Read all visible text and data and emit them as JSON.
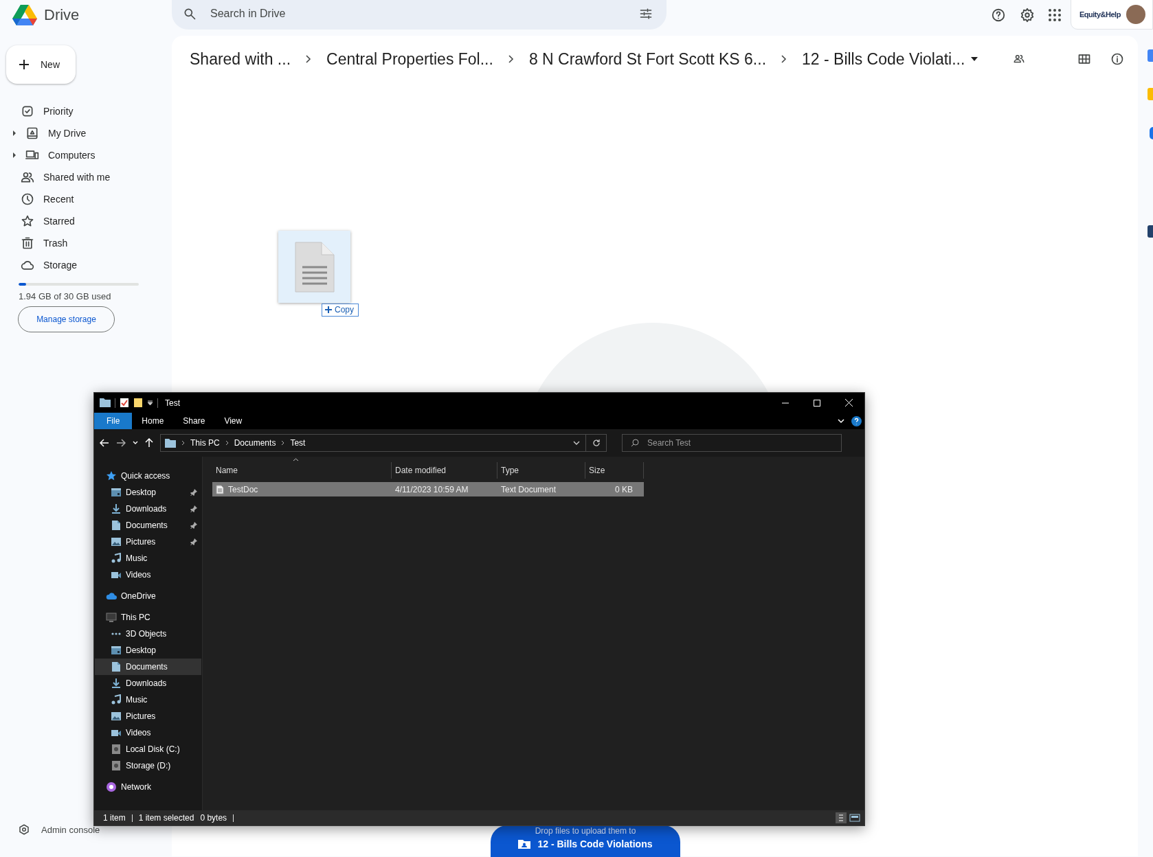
{
  "app": {
    "name": "Drive"
  },
  "search": {
    "placeholder": "Search in Drive"
  },
  "account": {
    "label": "Equity&Help"
  },
  "new_button": "New",
  "sidebar": {
    "items": [
      {
        "label": "Priority",
        "kind": "priority",
        "has_children": false
      },
      {
        "label": "My Drive",
        "kind": "drive",
        "has_children": true
      },
      {
        "label": "Computers",
        "kind": "computers",
        "has_children": true
      },
      {
        "label": "Shared with me",
        "kind": "shared",
        "has_children": false
      },
      {
        "label": "Recent",
        "kind": "recent",
        "has_children": false
      },
      {
        "label": "Starred",
        "kind": "starred",
        "has_children": false
      },
      {
        "label": "Trash",
        "kind": "trash",
        "has_children": false
      },
      {
        "label": "Storage",
        "kind": "storage",
        "has_children": false
      }
    ]
  },
  "storage": {
    "level": 0.065,
    "text": "1.94 GB of 30 GB used",
    "button": "Manage storage"
  },
  "admin": "Admin console",
  "breadcrumbs": [
    "Shared with ...",
    "Central Properties Fol...",
    "8 N Crawford St Fort Scott KS 6...",
    "12 - Bills Code Violati..."
  ],
  "drag": {
    "badge": "Copy"
  },
  "drop_banner": {
    "line1": "Drop files to upload them to",
    "folder": "12 - Bills Code Violations"
  },
  "explorer": {
    "title": "Test",
    "ribbon_tabs": [
      {
        "label": "File",
        "selected": true
      },
      {
        "label": "Home",
        "selected": false
      },
      {
        "label": "Share",
        "selected": false
      },
      {
        "label": "View",
        "selected": false
      }
    ],
    "address": [
      "This PC",
      "Documents",
      "Test"
    ],
    "search_placeholder": "Search Test",
    "columns": [
      "Name",
      "Date modified",
      "Type",
      "Size"
    ],
    "rows": [
      {
        "name": "TestDoc",
        "date": "4/11/2023 10:59 AM",
        "type": "Text Document",
        "size": "0 KB",
        "selected": true
      }
    ],
    "nav": [
      {
        "label": "Quick access",
        "kind": "star",
        "pinned": false,
        "selected": false,
        "children": [
          {
            "label": "Desktop",
            "kind": "desktop",
            "pinned": true,
            "selected": false
          },
          {
            "label": "Downloads",
            "kind": "downloads",
            "pinned": true,
            "selected": false
          },
          {
            "label": "Documents",
            "kind": "documents",
            "pinned": true,
            "selected": false
          },
          {
            "label": "Pictures",
            "kind": "pictures",
            "pinned": true,
            "selected": false
          },
          {
            "label": "Music",
            "kind": "music",
            "pinned": false,
            "selected": false
          },
          {
            "label": "Videos",
            "kind": "videos",
            "pinned": false,
            "selected": false
          }
        ]
      },
      {
        "label": "OneDrive",
        "kind": "cloud",
        "pinned": false,
        "selected": false
      },
      {
        "label": "This PC",
        "kind": "pc",
        "pinned": false,
        "selected": false,
        "children": [
          {
            "label": "3D Objects",
            "kind": "objects",
            "pinned": false,
            "selected": false
          },
          {
            "label": "Desktop",
            "kind": "desktop",
            "pinned": false,
            "selected": false
          },
          {
            "label": "Documents",
            "kind": "documents",
            "pinned": false,
            "selected": true
          },
          {
            "label": "Downloads",
            "kind": "downloads",
            "pinned": false,
            "selected": false
          },
          {
            "label": "Music",
            "kind": "music",
            "pinned": false,
            "selected": false
          },
          {
            "label": "Pictures",
            "kind": "pictures",
            "pinned": false,
            "selected": false
          },
          {
            "label": "Videos",
            "kind": "videos",
            "pinned": false,
            "selected": false
          },
          {
            "label": "Local Disk (C:)",
            "kind": "disk",
            "pinned": false,
            "selected": false
          },
          {
            "label": "Storage (D:)",
            "kind": "disk",
            "pinned": false,
            "selected": false
          }
        ]
      },
      {
        "label": "Network",
        "kind": "network",
        "pinned": false,
        "selected": false
      }
    ],
    "status": {
      "count": "1 item",
      "selected": "1 item selected",
      "size": "0 bytes"
    }
  }
}
